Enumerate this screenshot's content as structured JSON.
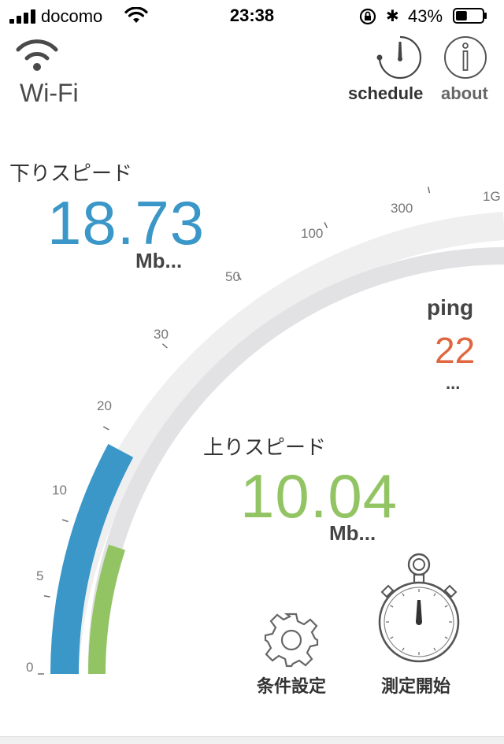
{
  "status_bar": {
    "carrier": "docomo",
    "time": "23:38",
    "battery_percent": "43%",
    "battery_level": 0.43
  },
  "header": {
    "network_type": "Wi-Fi",
    "schedule_label": "schedule",
    "about_label": "about"
  },
  "gauge": {
    "scale_labels": [
      "0",
      "5",
      "10",
      "20",
      "30",
      "50",
      "100",
      "300",
      "1G"
    ],
    "download_fill_value": "18.73",
    "upload_fill_value": "10.04",
    "colors": {
      "download": "#3a97c8",
      "upload": "#93c464",
      "track_outer": "#efefef",
      "track_inner": "#e2e2e4",
      "ping": "#e0673f"
    }
  },
  "download": {
    "label": "下りスピード",
    "value": "18.73",
    "unit": "Mb..."
  },
  "ping": {
    "label": "ping",
    "value": "22",
    "unit": "..."
  },
  "upload": {
    "label": "上りスピード",
    "value": "10.04",
    "unit": "Mb..."
  },
  "actions": {
    "settings_label": "条件設定",
    "start_label": "測定開始"
  }
}
